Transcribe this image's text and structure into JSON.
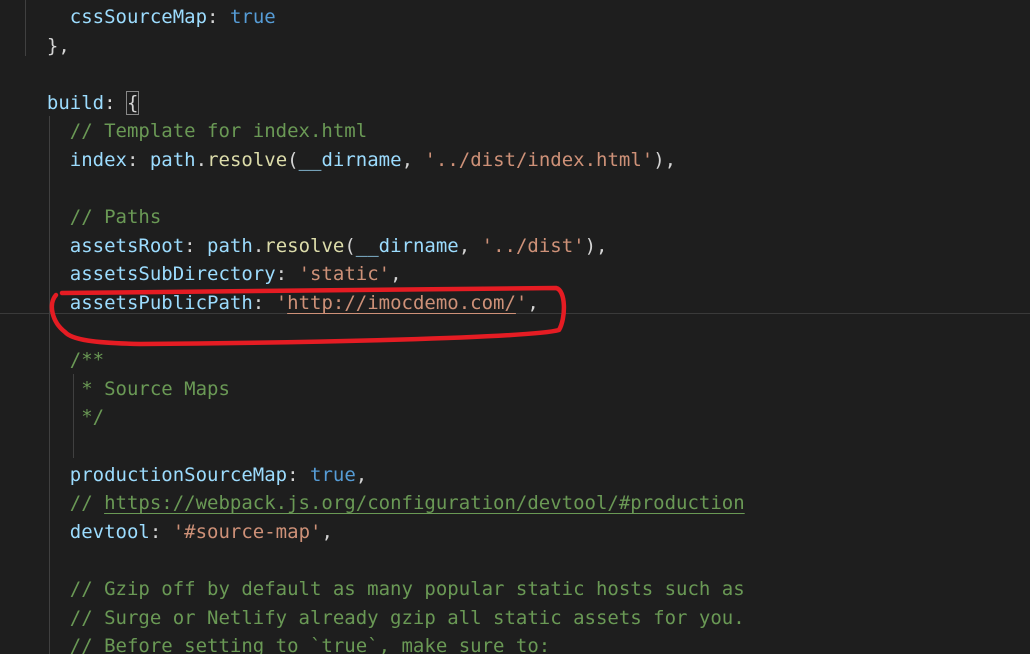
{
  "code_lines": [
    {
      "indent": "    ",
      "tokens": [
        {
          "t": "cssSourceMap",
          "c": "key"
        },
        {
          "t": ": ",
          "c": "punc"
        },
        {
          "t": "true",
          "c": "bool"
        }
      ]
    },
    {
      "indent": "  ",
      "tokens": [
        {
          "t": "},",
          "c": "punc"
        }
      ]
    },
    {
      "indent": "",
      "tokens": []
    },
    {
      "indent": "  ",
      "tokens": [
        {
          "t": "build",
          "c": "key"
        },
        {
          "t": ": ",
          "c": "punc"
        },
        {
          "t": "{",
          "c": "punc",
          "m": "brace"
        }
      ]
    },
    {
      "indent": "    ",
      "tokens": [
        {
          "t": "// Template for index.html",
          "c": "cmt"
        }
      ]
    },
    {
      "indent": "    ",
      "tokens": [
        {
          "t": "index",
          "c": "key"
        },
        {
          "t": ": ",
          "c": "punc"
        },
        {
          "t": "path",
          "c": "id"
        },
        {
          "t": ".",
          "c": "punc"
        },
        {
          "t": "resolve",
          "c": "fn"
        },
        {
          "t": "(",
          "c": "punc"
        },
        {
          "t": "__dirname",
          "c": "id"
        },
        {
          "t": ", ",
          "c": "punc"
        },
        {
          "t": "'../dist/index.html'",
          "c": "str"
        },
        {
          "t": "),",
          "c": "punc"
        }
      ]
    },
    {
      "indent": "",
      "tokens": []
    },
    {
      "indent": "    ",
      "tokens": [
        {
          "t": "// Paths",
          "c": "cmt"
        }
      ]
    },
    {
      "indent": "    ",
      "tokens": [
        {
          "t": "assetsRoot",
          "c": "key"
        },
        {
          "t": ": ",
          "c": "punc"
        },
        {
          "t": "path",
          "c": "id"
        },
        {
          "t": ".",
          "c": "punc"
        },
        {
          "t": "resolve",
          "c": "fn"
        },
        {
          "t": "(",
          "c": "punc"
        },
        {
          "t": "__dirname",
          "c": "id"
        },
        {
          "t": ", ",
          "c": "punc"
        },
        {
          "t": "'../dist'",
          "c": "str"
        },
        {
          "t": "),",
          "c": "punc"
        }
      ]
    },
    {
      "indent": "    ",
      "tokens": [
        {
          "t": "assetsSubDirectory",
          "c": "key"
        },
        {
          "t": ": ",
          "c": "punc"
        },
        {
          "t": "'static'",
          "c": "str"
        },
        {
          "t": ",",
          "c": "punc"
        }
      ]
    },
    {
      "indent": "    ",
      "tokens": [
        {
          "t": "assetsPublicPath",
          "c": "key"
        },
        {
          "t": ": ",
          "c": "punc"
        },
        {
          "t": "'",
          "c": "str"
        },
        {
          "t": "http://imocdemo.com/",
          "c": "str",
          "m": "link"
        },
        {
          "t": "'",
          "c": "str"
        },
        {
          "t": ",",
          "c": "punc"
        }
      ]
    },
    {
      "indent": "",
      "tokens": []
    },
    {
      "indent": "    ",
      "tokens": [
        {
          "t": "/**",
          "c": "cmt"
        }
      ]
    },
    {
      "indent": "     ",
      "tokens": [
        {
          "t": "* Source Maps",
          "c": "cmt"
        }
      ]
    },
    {
      "indent": "     ",
      "tokens": [
        {
          "t": "*/",
          "c": "cmt"
        }
      ]
    },
    {
      "indent": "",
      "tokens": []
    },
    {
      "indent": "    ",
      "tokens": [
        {
          "t": "productionSourceMap",
          "c": "key"
        },
        {
          "t": ": ",
          "c": "punc"
        },
        {
          "t": "true",
          "c": "bool"
        },
        {
          "t": ",",
          "c": "punc"
        }
      ]
    },
    {
      "indent": "    ",
      "tokens": [
        {
          "t": "// ",
          "c": "cmt"
        },
        {
          "t": "https://webpack.js.org/configuration/devtool/#production",
          "c": "cmt",
          "m": "link"
        }
      ]
    },
    {
      "indent": "    ",
      "tokens": [
        {
          "t": "devtool",
          "c": "key"
        },
        {
          "t": ": ",
          "c": "punc"
        },
        {
          "t": "'#source-map'",
          "c": "str"
        },
        {
          "t": ",",
          "c": "punc"
        }
      ]
    },
    {
      "indent": "",
      "tokens": []
    },
    {
      "indent": "    ",
      "tokens": [
        {
          "t": "// Gzip off by default as many popular static hosts such as",
          "c": "cmt"
        }
      ]
    },
    {
      "indent": "    ",
      "tokens": [
        {
          "t": "// Surge or Netlify already gzip all static assets for you.",
          "c": "cmt"
        }
      ]
    },
    {
      "indent": "    ",
      "tokens": [
        {
          "t": "// Before setting to `true`, make sure to:",
          "c": "cmt"
        }
      ]
    }
  ],
  "colors": {
    "background": "#1e1e1e",
    "property": "#9cdcfe",
    "keyword": "#569cd6",
    "string": "#ce9178",
    "comment": "#6a9955",
    "function": "#dcdcaa",
    "annotation": "#e51c23"
  }
}
